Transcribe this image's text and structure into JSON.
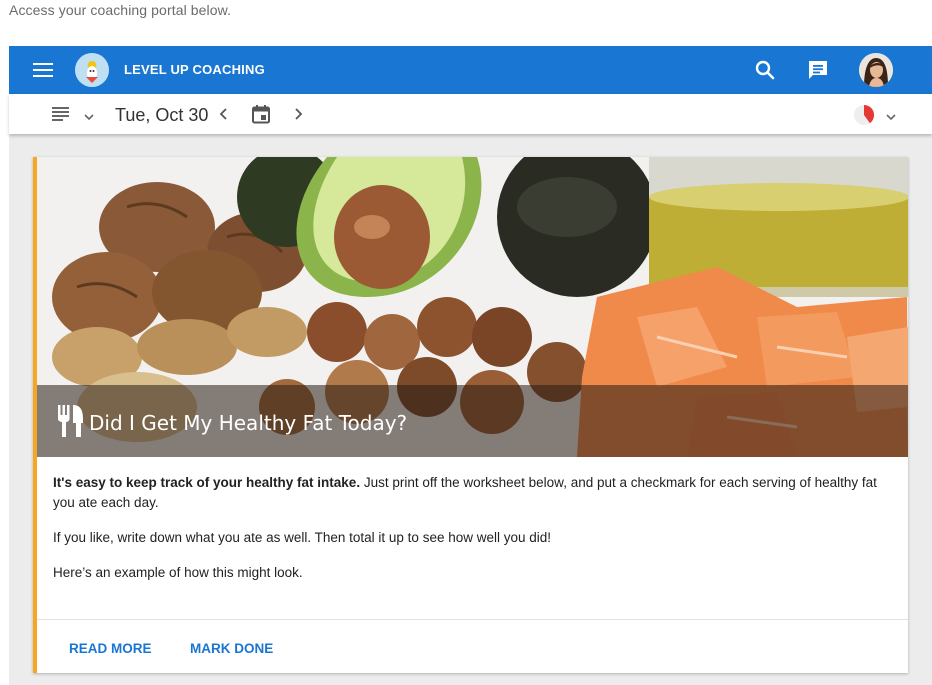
{
  "intro_text": "Access your coaching portal below.",
  "app": {
    "title": "LEVEL UP COACHING",
    "brand_color": "#1976d2"
  },
  "toolbar": {
    "date": "Tue, Oct 30"
  },
  "card": {
    "accent_color": "#f5a623",
    "title": "Did I Get My Healthy Fat Today?",
    "intro_bold": "It's easy to keep track of your healthy fat intake.",
    "intro_rest": " Just print off the worksheet below, and put a checkmark for each serving of healthy fat you ate each day.",
    "paragraph_2": "If you like, write down what you ate as well. Then total it up to see how well you did!",
    "paragraph_3": "Here’s an example of how this might look.",
    "actions": {
      "read_more": "READ MORE",
      "mark_done": "MARK DONE"
    }
  },
  "icons": [
    "menu-icon",
    "search-icon",
    "chat-icon",
    "list-view-icon",
    "chevron-down-icon",
    "chevron-left-icon",
    "calendar-icon",
    "chevron-right-icon",
    "progress-pie-icon",
    "fork-knife-icon"
  ]
}
